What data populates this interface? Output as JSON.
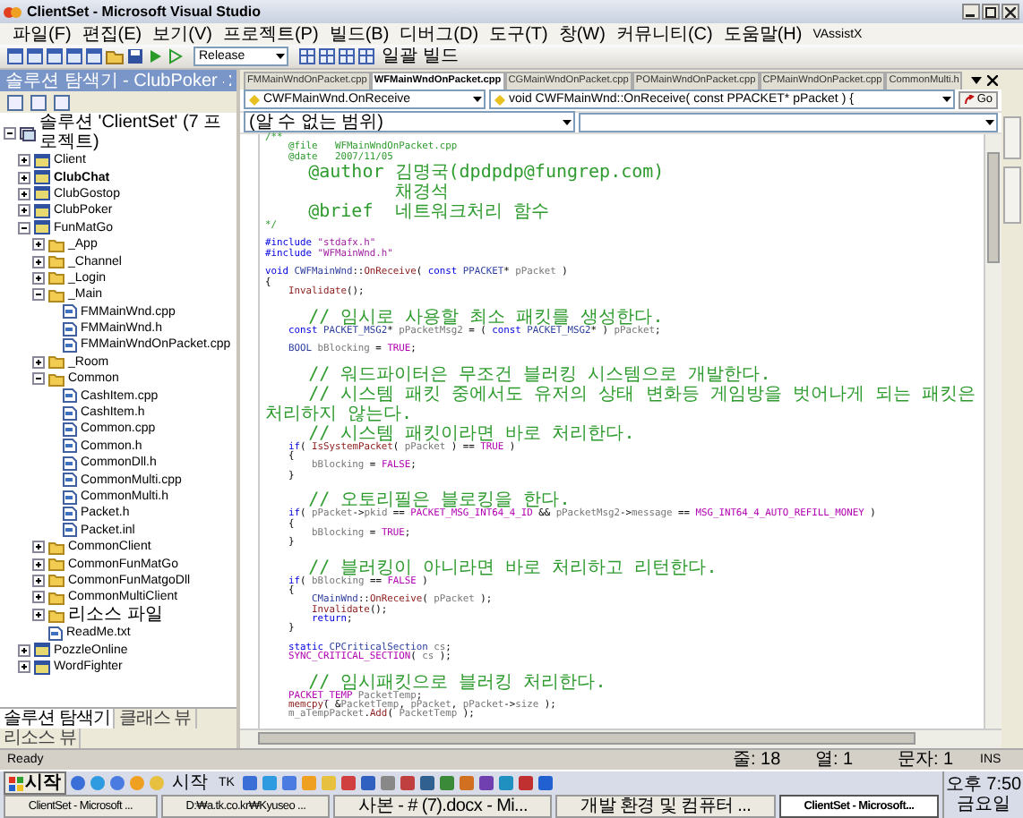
{
  "window": {
    "title": "ClientSet - Microsoft Visual Studio"
  },
  "menu": [
    "파일(F)",
    "편집(E)",
    "보기(V)",
    "프로젝트(P)",
    "빌드(B)",
    "디버그(D)",
    "도구(T)",
    "창(W)",
    "커뮤니티(C)",
    "도움말(H)",
    "VAssistX"
  ],
  "toolbar": {
    "configuration": "Release",
    "batch_build": "일괄 빌드"
  },
  "solution_explorer": {
    "title": "솔루션 탐색기 - ClubPoker",
    "tree": [
      {
        "label": "솔루션 'ClientSet' (7 프로젝트)",
        "kind": "solution",
        "expanded": true,
        "children": [
          {
            "label": "Client",
            "kind": "project",
            "startup": false,
            "expanded": false
          },
          {
            "label": "ClubChat",
            "kind": "project",
            "startup": true,
            "expanded": false
          },
          {
            "label": "ClubGostop",
            "kind": "project",
            "startup": false,
            "expanded": false
          },
          {
            "label": "ClubPoker",
            "kind": "project",
            "startup": false,
            "expanded": false
          },
          {
            "label": "FunMatGo",
            "kind": "project",
            "startup": false,
            "expanded": true,
            "children": [
              {
                "label": "_App",
                "kind": "folder",
                "expanded": false
              },
              {
                "label": "_Channel",
                "kind": "folder",
                "expanded": false
              },
              {
                "label": "_Login",
                "kind": "folder",
                "expanded": false
              },
              {
                "label": "_Main",
                "kind": "folder",
                "expanded": true,
                "children": [
                  {
                    "label": "FMMainWnd.cpp",
                    "kind": "file"
                  },
                  {
                    "label": "FMMainWnd.h",
                    "kind": "file"
                  },
                  {
                    "label": "FMMainWndOnPacket.cpp",
                    "kind": "file"
                  }
                ]
              },
              {
                "label": "_Room",
                "kind": "folder",
                "expanded": false
              },
              {
                "label": "Common",
                "kind": "folder",
                "expanded": true,
                "children": [
                  {
                    "label": "CashItem.cpp",
                    "kind": "file"
                  },
                  {
                    "label": "CashItem.h",
                    "kind": "file"
                  },
                  {
                    "label": "Common.cpp",
                    "kind": "file"
                  },
                  {
                    "label": "Common.h",
                    "kind": "file"
                  },
                  {
                    "label": "CommonDll.h",
                    "kind": "file"
                  },
                  {
                    "label": "CommonMulti.cpp",
                    "kind": "file"
                  },
                  {
                    "label": "CommonMulti.h",
                    "kind": "file"
                  },
                  {
                    "label": "Packet.h",
                    "kind": "file"
                  },
                  {
                    "label": "Packet.inl",
                    "kind": "file"
                  }
                ]
              },
              {
                "label": "CommonClient",
                "kind": "folder",
                "expanded": false
              },
              {
                "label": "CommonFunMatGo",
                "kind": "folder",
                "expanded": false
              },
              {
                "label": "CommonFunMatgoDll",
                "kind": "folder",
                "expanded": false
              },
              {
                "label": "CommonMultiClient",
                "kind": "folder",
                "expanded": false
              },
              {
                "label": "리소스 파일",
                "kind": "folder",
                "expanded": false
              },
              {
                "label": "ReadMe.txt",
                "kind": "file"
              }
            ]
          },
          {
            "label": "PozzleOnline",
            "kind": "project",
            "startup": false,
            "expanded": false
          },
          {
            "label": "WordFighter",
            "kind": "project",
            "startup": false,
            "expanded": false
          }
        ]
      }
    ],
    "tabs": [
      {
        "label": "솔루션 탐색기",
        "selected": true
      },
      {
        "label": "클래스 뷰",
        "selected": false
      },
      {
        "label": "리소스 뷰",
        "selected": false
      }
    ]
  },
  "editor": {
    "tabs": [
      {
        "label": "FMMainWndOnPacket.cpp",
        "selected": false
      },
      {
        "label": "WFMainWndOnPacket.cpp",
        "selected": true
      },
      {
        "label": "CGMainWndOnPacket.cpp",
        "selected": false
      },
      {
        "label": "POMainWndOnPacket.cpp",
        "selected": false
      },
      {
        "label": "CPMainWndOnPacket.cpp",
        "selected": false
      },
      {
        "label": "CommonMulti.h",
        "selected": false
      }
    ],
    "class_dropdown": "CWFMainWnd.OnReceive",
    "member_dropdown": "void CWFMainWnd::OnReceive( const PPACKET* pPacket ) {",
    "go": "Go",
    "scope_dropdown": "(알 수 없는 범위)",
    "code": [
      {
        "kind": "code",
        "tokens": [
          {
            "kind": "cm",
            "text": "/**"
          }
        ]
      },
      {
        "kind": "code",
        "tokens": [
          {
            "kind": "cm",
            "text": "    @file   WFMainWndOnPacket.cpp"
          }
        ]
      },
      {
        "kind": "code",
        "tokens": [
          {
            "kind": "cm",
            "text": "    @date   2007/11/05"
          }
        ]
      },
      {
        "kind": "code",
        "tokens": [
          {
            "kind": "cm",
            "text": "    @author 김명국(dpdpdp@fungrep.com)"
          }
        ]
      },
      {
        "kind": "code",
        "tokens": [
          {
            "kind": "cm",
            "text": "            채경석"
          }
        ]
      },
      {
        "kind": "code",
        "tokens": [
          {
            "kind": "cm",
            "text": "    @brief  네트워크처리 함수"
          }
        ]
      },
      {
        "kind": "code",
        "tokens": [
          {
            "kind": "cm",
            "text": "*/"
          }
        ]
      },
      {
        "kind": "blank"
      },
      {
        "kind": "code",
        "tokens": [
          {
            "kind": "pp",
            "text": "#include"
          },
          {
            "kind": "str",
            "text": " \"stdafx.h\""
          }
        ]
      },
      {
        "kind": "code",
        "tokens": [
          {
            "kind": "pp",
            "text": "#include"
          },
          {
            "kind": "str",
            "text": " \"WFMainWnd.h\""
          }
        ]
      },
      {
        "kind": "blank"
      },
      {
        "kind": "code",
        "tokens": [
          {
            "kind": "kw",
            "text": "void"
          },
          {
            "kind": "ty",
            "text": " CWFMainWnd"
          },
          {
            "kind": "tx",
            "text": "::"
          },
          {
            "kind": "fn",
            "text": "OnReceive"
          },
          {
            "kind": "tx",
            "text": "( "
          },
          {
            "kind": "kw",
            "text": "const"
          },
          {
            "kind": "ty",
            "text": " PPACKET"
          },
          {
            "kind": "tx",
            "text": "* "
          },
          {
            "kind": "var",
            "text": "pPacket"
          },
          {
            "kind": "tx",
            "text": " )"
          }
        ]
      },
      {
        "kind": "code",
        "tokens": [
          {
            "kind": "tx",
            "text": "{"
          }
        ]
      },
      {
        "kind": "code",
        "tokens": [
          {
            "kind": "fn",
            "text": "    Invalidate"
          },
          {
            "kind": "tx",
            "text": "();"
          }
        ]
      },
      {
        "kind": "blank"
      },
      {
        "kind": "code",
        "tokens": [
          {
            "kind": "cm",
            "text": "    // 임시로 사용할 최소 패킷를 생성한다."
          }
        ]
      },
      {
        "kind": "code",
        "tokens": [
          {
            "kind": "kw",
            "text": "    const"
          },
          {
            "kind": "ty",
            "text": " PACKET_MSG2"
          },
          {
            "kind": "tx",
            "text": "* "
          },
          {
            "kind": "var",
            "text": "pPacketMsg2"
          },
          {
            "kind": "tx",
            "text": " = ( "
          },
          {
            "kind": "kw",
            "text": "const"
          },
          {
            "kind": "ty",
            "text": " PACKET_MSG2"
          },
          {
            "kind": "tx",
            "text": "* ) "
          },
          {
            "kind": "var",
            "text": "pPacket"
          },
          {
            "kind": "tx",
            "text": ";"
          }
        ]
      },
      {
        "kind": "blank"
      },
      {
        "kind": "code",
        "tokens": [
          {
            "kind": "ty",
            "text": "    BOOL"
          },
          {
            "kind": "var",
            "text": " bBlocking"
          },
          {
            "kind": "tx",
            "text": " = "
          },
          {
            "kind": "mac",
            "text": "TRUE"
          },
          {
            "kind": "tx",
            "text": ";"
          }
        ]
      },
      {
        "kind": "blank"
      },
      {
        "kind": "code",
        "tokens": [
          {
            "kind": "cm",
            "text": "    // 워드파이터은 무조건 블러킹 시스템으로 개발한다."
          }
        ]
      },
      {
        "kind": "code",
        "tokens": [
          {
            "kind": "cm",
            "text": "    // 시스템 패킷 중에서도 유저의 상태 변화등 게임방을 벗어나게 되는 패킷은 처리하지 않는다."
          }
        ]
      },
      {
        "kind": "code",
        "tokens": [
          {
            "kind": "cm",
            "text": "    // 시스템 패킷이라면 바로 처리한다."
          }
        ]
      },
      {
        "kind": "code",
        "tokens": [
          {
            "kind": "kw",
            "text": "    if"
          },
          {
            "kind": "tx",
            "text": "( "
          },
          {
            "kind": "fn",
            "text": "IsSystemPacket"
          },
          {
            "kind": "tx",
            "text": "( "
          },
          {
            "kind": "var",
            "text": "pPacket"
          },
          {
            "kind": "tx",
            "text": " ) == "
          },
          {
            "kind": "mac",
            "text": "TRUE"
          },
          {
            "kind": "tx",
            "text": " )"
          }
        ]
      },
      {
        "kind": "code",
        "tokens": [
          {
            "kind": "tx",
            "text": "    {"
          }
        ]
      },
      {
        "kind": "code",
        "tokens": [
          {
            "kind": "var",
            "text": "        bBlocking"
          },
          {
            "kind": "tx",
            "text": " = "
          },
          {
            "kind": "mac",
            "text": "FALSE"
          },
          {
            "kind": "tx",
            "text": ";"
          }
        ]
      },
      {
        "kind": "code",
        "tokens": [
          {
            "kind": "tx",
            "text": "    }"
          }
        ]
      },
      {
        "kind": "blank"
      },
      {
        "kind": "code",
        "tokens": [
          {
            "kind": "cm",
            "text": "    // 오토리필은 블로킹을 한다."
          }
        ]
      },
      {
        "kind": "code",
        "tokens": [
          {
            "kind": "kw",
            "text": "    if"
          },
          {
            "kind": "tx",
            "text": "( "
          },
          {
            "kind": "var",
            "text": "pPacket"
          },
          {
            "kind": "tx",
            "text": "->"
          },
          {
            "kind": "var",
            "text": "pkid"
          },
          {
            "kind": "tx",
            "text": " == "
          },
          {
            "kind": "mac",
            "text": "PACKET_MSG_INT64_4_ID"
          },
          {
            "kind": "tx",
            "text": " && "
          },
          {
            "kind": "var",
            "text": "pPacketMsg2"
          },
          {
            "kind": "tx",
            "text": "->"
          },
          {
            "kind": "var",
            "text": "message"
          },
          {
            "kind": "tx",
            "text": " == "
          },
          {
            "kind": "mac",
            "text": "MSG_INT64_4_AUTO_REFILL_MONEY"
          },
          {
            "kind": "tx",
            "text": " )"
          }
        ]
      },
      {
        "kind": "code",
        "tokens": [
          {
            "kind": "tx",
            "text": "    {"
          }
        ]
      },
      {
        "kind": "code",
        "tokens": [
          {
            "kind": "var",
            "text": "        bBlocking"
          },
          {
            "kind": "tx",
            "text": " = "
          },
          {
            "kind": "mac",
            "text": "TRUE"
          },
          {
            "kind": "tx",
            "text": ";"
          }
        ]
      },
      {
        "kind": "code",
        "tokens": [
          {
            "kind": "tx",
            "text": "    }"
          }
        ]
      },
      {
        "kind": "blank"
      },
      {
        "kind": "code",
        "tokens": [
          {
            "kind": "cm",
            "text": "    // 블러킹이 아니라면 바로 처리하고 리턴한다."
          }
        ]
      },
      {
        "kind": "code",
        "tokens": [
          {
            "kind": "kw",
            "text": "    if"
          },
          {
            "kind": "tx",
            "text": "( "
          },
          {
            "kind": "var",
            "text": "bBlocking"
          },
          {
            "kind": "tx",
            "text": " == "
          },
          {
            "kind": "mac",
            "text": "FALSE"
          },
          {
            "kind": "tx",
            "text": " )"
          }
        ]
      },
      {
        "kind": "code",
        "tokens": [
          {
            "kind": "tx",
            "text": "    {"
          }
        ]
      },
      {
        "kind": "code",
        "tokens": [
          {
            "kind": "ty",
            "text": "        CMainWnd"
          },
          {
            "kind": "tx",
            "text": "::"
          },
          {
            "kind": "fn",
            "text": "OnReceive"
          },
          {
            "kind": "tx",
            "text": "( "
          },
          {
            "kind": "var",
            "text": "pPacket"
          },
          {
            "kind": "tx",
            "text": " );"
          }
        ]
      },
      {
        "kind": "code",
        "tokens": [
          {
            "kind": "fn",
            "text": "        Invalidate"
          },
          {
            "kind": "tx",
            "text": "();"
          }
        ]
      },
      {
        "kind": "code",
        "tokens": [
          {
            "kind": "kw",
            "text": "        return"
          },
          {
            "kind": "tx",
            "text": ";"
          }
        ]
      },
      {
        "kind": "code",
        "tokens": [
          {
            "kind": "tx",
            "text": "    }"
          }
        ]
      },
      {
        "kind": "blank"
      },
      {
        "kind": "code",
        "tokens": [
          {
            "kind": "kw",
            "text": "    static"
          },
          {
            "kind": "ty",
            "text": " CPCriticalSection"
          },
          {
            "kind": "var",
            "text": " cs"
          },
          {
            "kind": "tx",
            "text": ";"
          }
        ]
      },
      {
        "kind": "code",
        "tokens": [
          {
            "kind": "mac",
            "text": "    SYNC_CRITICAL_SECTION"
          },
          {
            "kind": "tx",
            "text": "( "
          },
          {
            "kind": "var",
            "text": "cs"
          },
          {
            "kind": "tx",
            "text": " );"
          }
        ]
      },
      {
        "kind": "blank"
      },
      {
        "kind": "code",
        "tokens": [
          {
            "kind": "cm",
            "text": "    // 임시패킷으로 블러킹 처리한다."
          }
        ]
      },
      {
        "kind": "code",
        "tokens": [
          {
            "kind": "mac",
            "text": "    PACKET_TEMP"
          },
          {
            "kind": "var",
            "text": " PacketTemp"
          },
          {
            "kind": "tx",
            "text": ";"
          }
        ]
      },
      {
        "kind": "code",
        "tokens": [
          {
            "kind": "fn",
            "text": "    memcpy"
          },
          {
            "kind": "tx",
            "text": "( &"
          },
          {
            "kind": "var",
            "text": "PacketTemp"
          },
          {
            "kind": "tx",
            "text": ", "
          },
          {
            "kind": "var",
            "text": "pPacket"
          },
          {
            "kind": "tx",
            "text": ", "
          },
          {
            "kind": "var",
            "text": "pPacket"
          },
          {
            "kind": "tx",
            "text": "->"
          },
          {
            "kind": "var",
            "text": "size"
          },
          {
            "kind": "tx",
            "text": " );"
          }
        ]
      },
      {
        "kind": "code",
        "tokens": [
          {
            "kind": "var",
            "text": "    m_aTempPacket"
          },
          {
            "kind": "tx",
            "text": "."
          },
          {
            "kind": "fn",
            "text": "Add"
          },
          {
            "kind": "tx",
            "text": "( "
          },
          {
            "kind": "var",
            "text": "PacketTemp"
          },
          {
            "kind": "tx",
            "text": " );"
          }
        ]
      }
    ]
  },
  "status_bar": {
    "message": "Ready",
    "line": "줄: 18",
    "column": "열: 1",
    "char": "문자: 1",
    "mode": "INS"
  },
  "taskbar": {
    "start": "시작",
    "quick_toolbars": [
      "시작",
      "TK"
    ],
    "tasks": [
      {
        "label": "ClientSet - Microsoft ...",
        "selected": false
      },
      {
        "label": "D:₩a.tk.co.kr₩Kyuseo ...",
        "selected": false
      },
      {
        "label": "사본 - # (7).docx - Mi...",
        "selected": false
      },
      {
        "label": "개발 환경 및 컴퓨터 ...",
        "selected": false
      },
      {
        "label": "ClientSet - Microsoft...",
        "selected": true
      }
    ],
    "clock": {
      "time": "오후 7:50",
      "day": "금요일"
    }
  }
}
